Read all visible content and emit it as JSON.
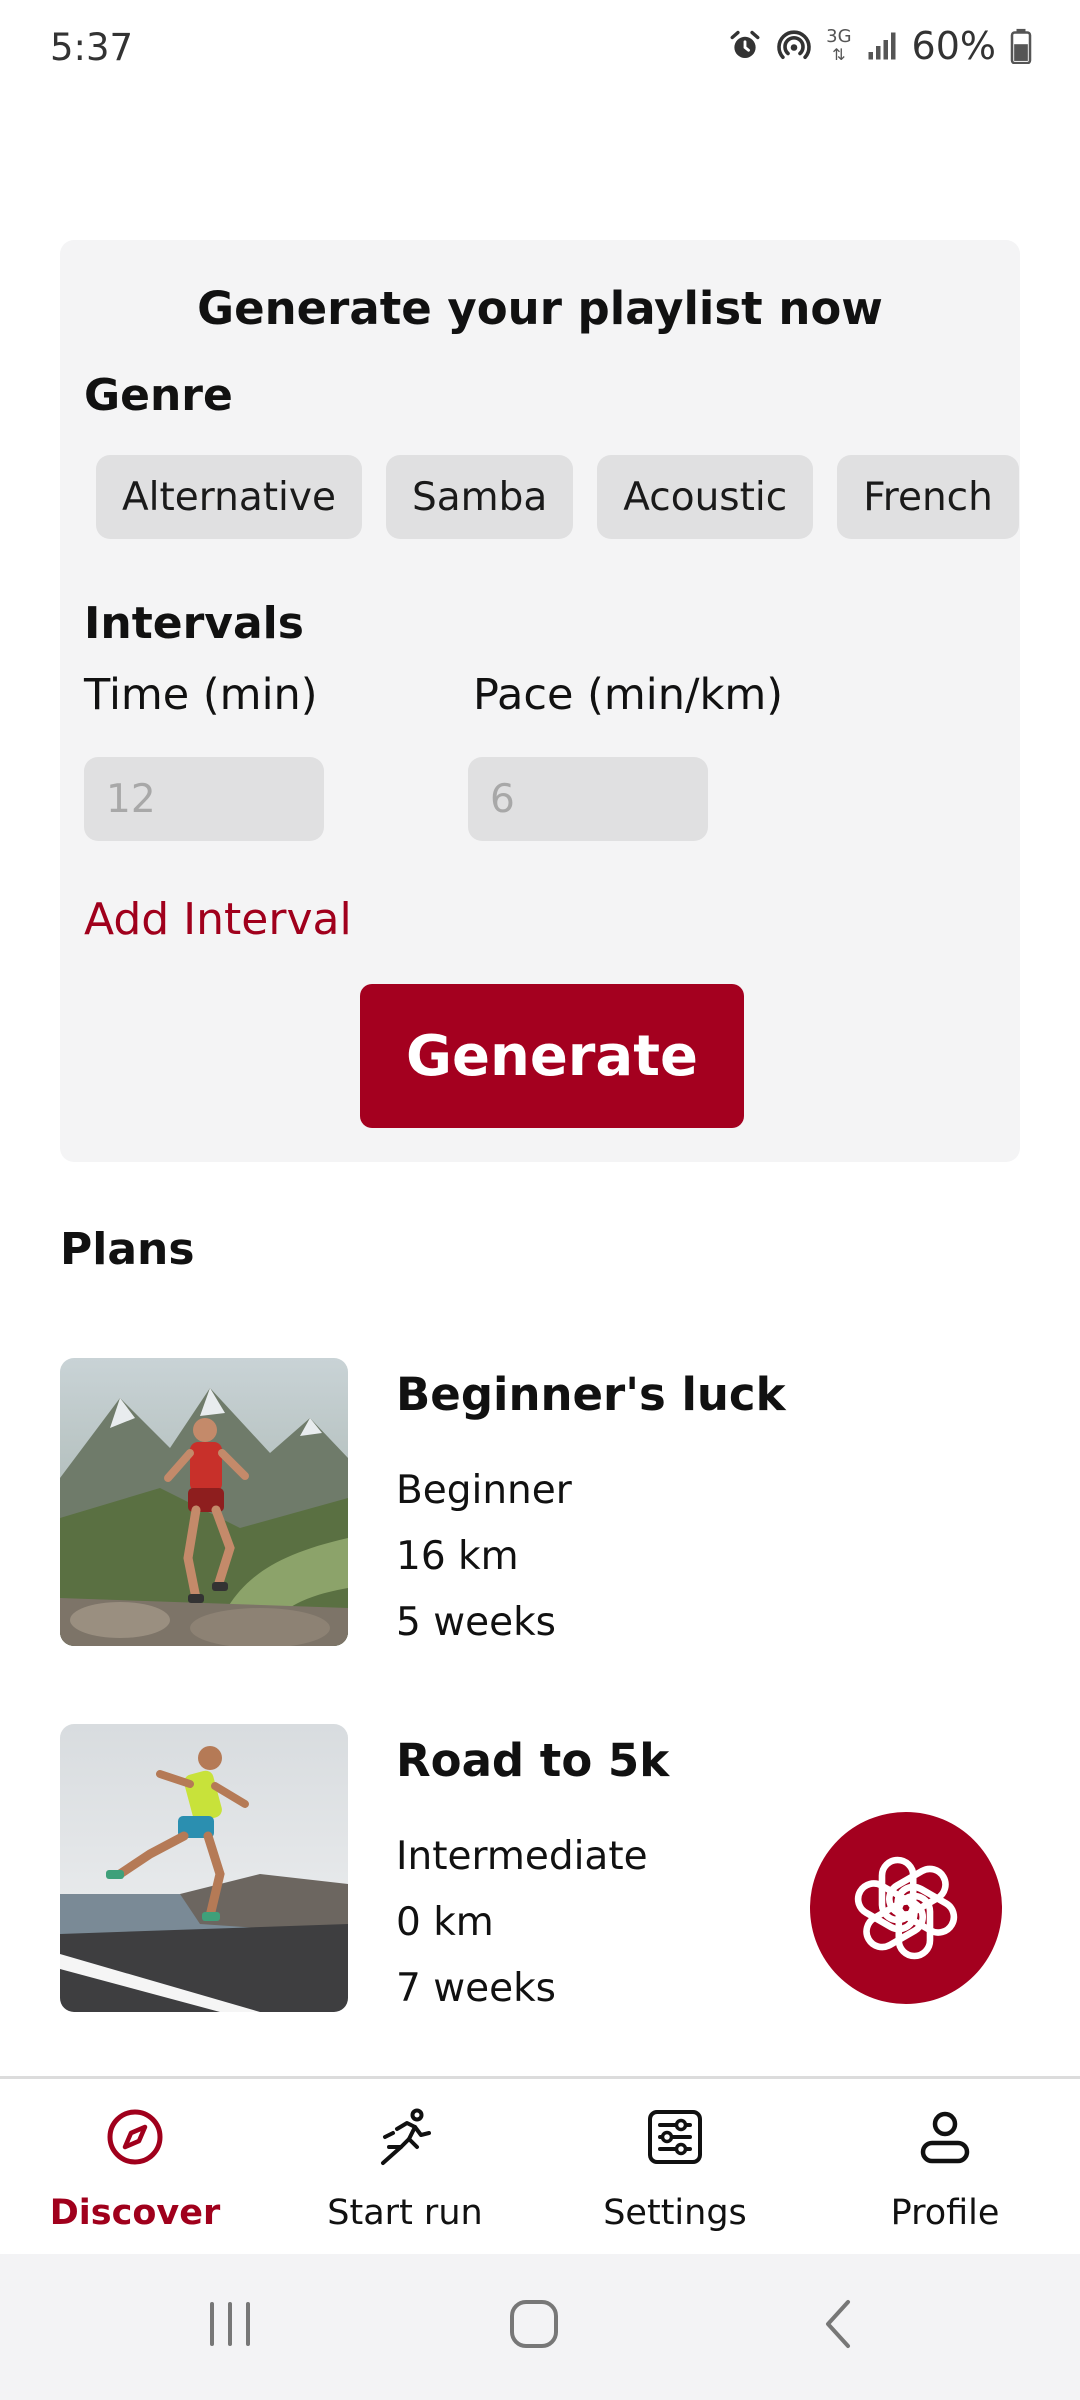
{
  "status_bar": {
    "time": "5:37",
    "network": "3G",
    "battery": "60%"
  },
  "generator": {
    "title": "Generate your playlist now",
    "genre_label": "Genre",
    "genres": [
      "Alternative",
      "Samba",
      "Acoustic",
      "French"
    ],
    "intervals_label": "Intervals",
    "time_label": "Time (min)",
    "pace_label": "Pace (min/km)",
    "time_placeholder": "12",
    "pace_placeholder": "6",
    "add_interval_label": "Add Interval",
    "generate_label": "Generate"
  },
  "plans": {
    "title": "Plans",
    "items": [
      {
        "name": "Beginner's luck",
        "level": "Beginner",
        "distance": "16 km",
        "duration": "5 weeks"
      },
      {
        "name": "Road to 5k",
        "level": "Intermediate",
        "distance": "0 km",
        "duration": "7 weeks"
      }
    ]
  },
  "bottom_nav": {
    "items": [
      {
        "label": "Discover",
        "icon": "compass-icon"
      },
      {
        "label": "Start run",
        "icon": "runner-icon"
      },
      {
        "label": "Settings",
        "icon": "sliders-icon"
      },
      {
        "label": "Profile",
        "icon": "person-icon"
      }
    ],
    "active": "Discover"
  },
  "colors": {
    "accent": "#a4001f",
    "card_bg": "#f4f4f5",
    "chip_bg": "#e0e0e1"
  }
}
